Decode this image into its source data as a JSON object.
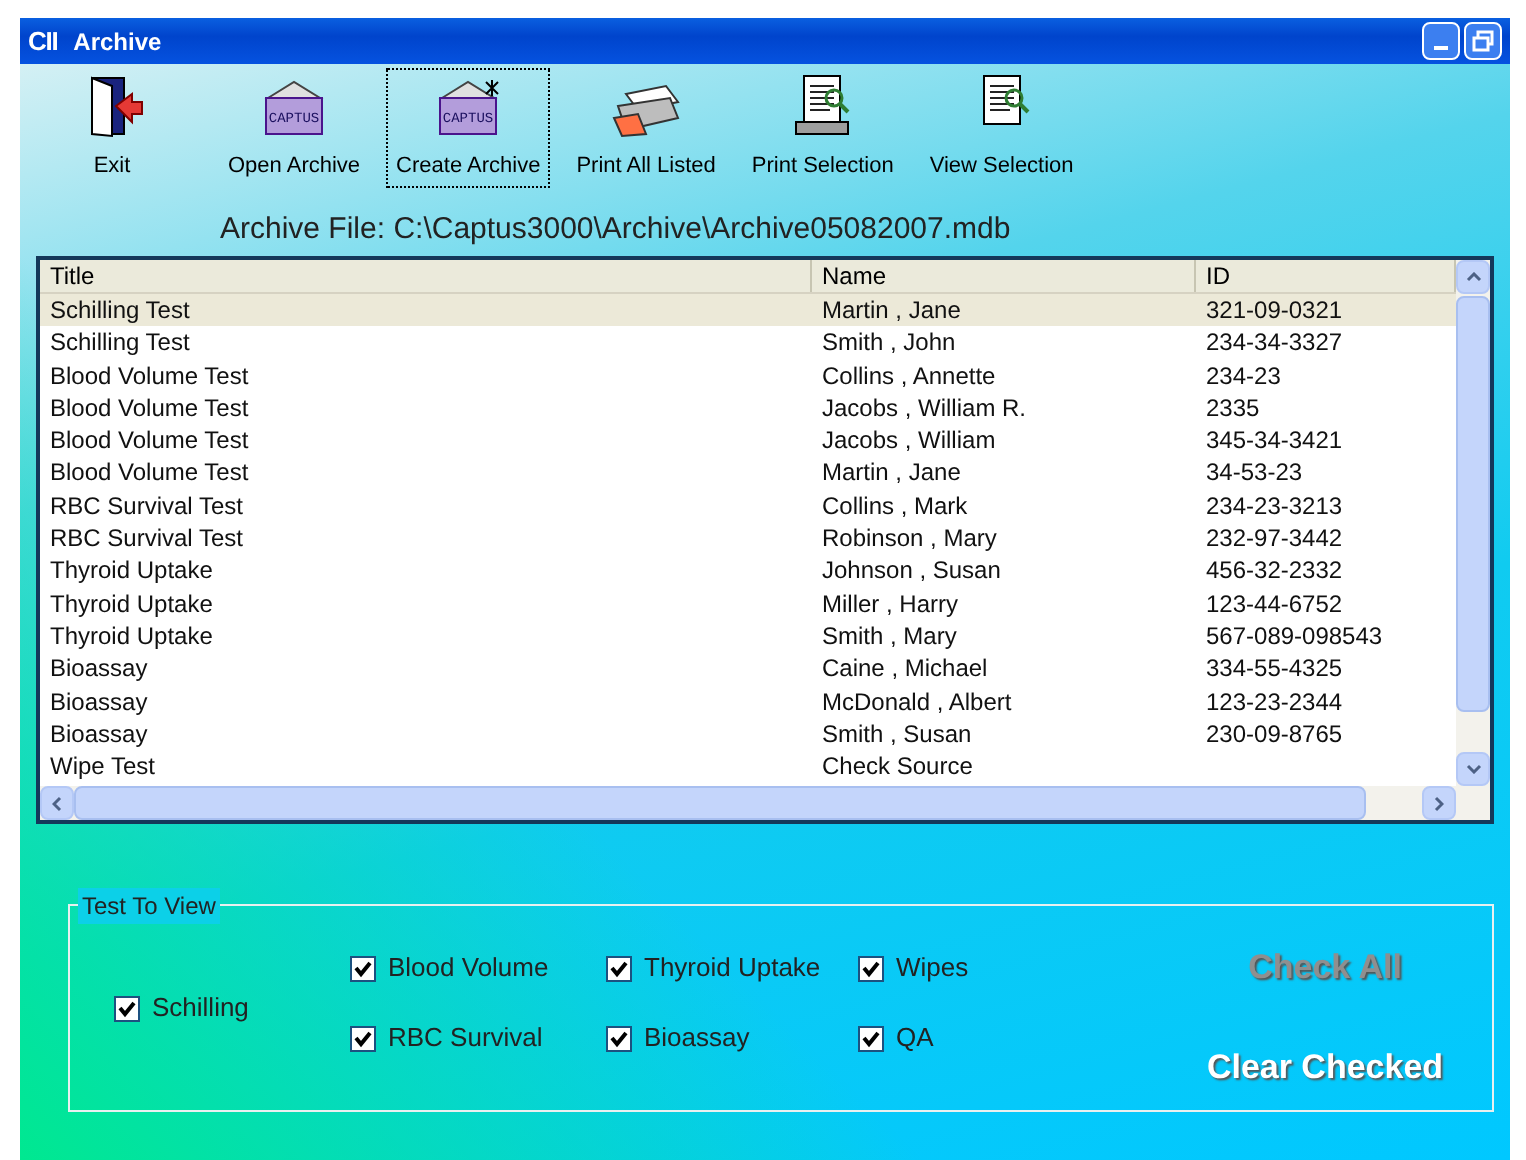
{
  "window": {
    "title": "Archive",
    "logo": "CII"
  },
  "toolbar": [
    {
      "kind": "exit",
      "label": "Exit",
      "focused": false
    },
    {
      "kind": "open",
      "label": "Open Archive",
      "focused": false,
      "icon_text": "CAPTUS"
    },
    {
      "kind": "create",
      "label": "Create Archive",
      "focused": true,
      "icon_text": "CAPTUS"
    },
    {
      "kind": "printall",
      "label": "Print All Listed",
      "focused": false
    },
    {
      "kind": "printsel",
      "label": "Print Selection",
      "focused": false
    },
    {
      "kind": "view",
      "label": "View Selection",
      "focused": false
    }
  ],
  "archive_file": "Archive File: C:\\Captus3000\\Archive\\Archive05082007.mdb",
  "table": {
    "columns": [
      "Title",
      "Name",
      "ID"
    ],
    "rows": [
      {
        "cells": [
          "Schilling Test",
          "Martin , Jane",
          "321-09-0321"
        ],
        "selected": true
      },
      {
        "cells": [
          "Schilling Test",
          "Smith , John",
          "234-34-3327"
        ],
        "selected": false
      },
      {
        "cells": [
          "Blood Volume Test",
          "Collins , Annette",
          "234-23"
        ],
        "selected": false
      },
      {
        "cells": [
          "Blood Volume Test",
          "Jacobs , William R.",
          "2335"
        ],
        "selected": false
      },
      {
        "cells": [
          "Blood Volume Test",
          "Jacobs , William",
          "345-34-3421"
        ],
        "selected": false
      },
      {
        "cells": [
          "Blood Volume Test",
          "Martin , Jane",
          "34-53-23"
        ],
        "selected": false
      },
      {
        "cells": [
          "RBC Survival Test",
          "Collins , Mark",
          "234-23-3213"
        ],
        "selected": false
      },
      {
        "cells": [
          "RBC Survival Test",
          "Robinson , Mary",
          "232-97-3442"
        ],
        "selected": false
      },
      {
        "cells": [
          "Thyroid Uptake",
          "Johnson , Susan",
          "456-32-2332"
        ],
        "selected": false
      },
      {
        "cells": [
          "Thyroid Uptake",
          "Miller , Harry",
          "123-44-6752"
        ],
        "selected": false
      },
      {
        "cells": [
          "Thyroid Uptake",
          "Smith , Mary",
          "567-089-098543"
        ],
        "selected": false
      },
      {
        "cells": [
          "Bioassay",
          "Caine , Michael",
          "334-55-4325"
        ],
        "selected": false
      },
      {
        "cells": [
          "Bioassay",
          "McDonald , Albert",
          "123-23-2344"
        ],
        "selected": false
      },
      {
        "cells": [
          "Bioassay",
          "Smith , Susan",
          "230-09-8765"
        ],
        "selected": false
      },
      {
        "cells": [
          "Wipe Test",
          "Check Source",
          ""
        ],
        "selected": false
      }
    ]
  },
  "test_to_view": {
    "title": "Test To View",
    "schilling": {
      "label": "Schilling",
      "checked": true
    },
    "options": [
      {
        "label": "Blood Volume",
        "checked": true
      },
      {
        "label": "Thyroid Uptake",
        "checked": true
      },
      {
        "label": "Wipes",
        "checked": true
      },
      {
        "label": "RBC Survival",
        "checked": true
      },
      {
        "label": "Bioassay",
        "checked": true
      },
      {
        "label": "QA",
        "checked": true
      }
    ],
    "buttons": [
      {
        "label": "Check All",
        "disabled": true
      },
      {
        "label": "Clear Checked",
        "disabled": false
      }
    ]
  }
}
